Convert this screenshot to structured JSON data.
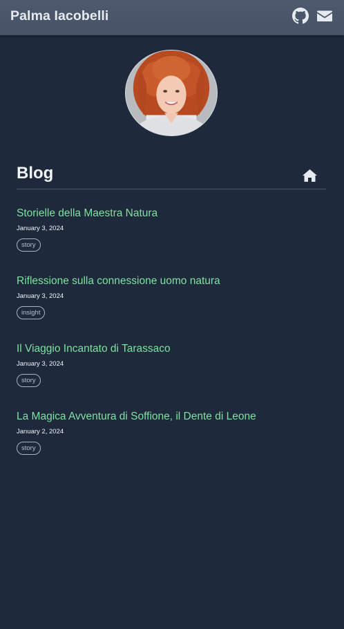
{
  "header": {
    "site_title": "Palma Iacobelli",
    "icons": [
      "github-icon",
      "envelope-icon"
    ]
  },
  "avatar": {
    "description": "profile-photo"
  },
  "section": {
    "title": "Blog",
    "home_icon": "home-icon"
  },
  "posts": [
    {
      "title": "Storielle della Maestra Natura",
      "date": "January 3, 2024",
      "tag": "story"
    },
    {
      "title": "Riflessione sulla connessione uomo natura",
      "date": "January 3, 2024",
      "tag": "insight"
    },
    {
      "title": "Il Viaggio Incantato di Tarassaco",
      "date": "January 3, 2024",
      "tag": "story"
    },
    {
      "title": "La Magica Avventura di Soffione, il Dente di Leone",
      "date": "January 2, 2024",
      "tag": "story"
    }
  ],
  "colors": {
    "background": "#1e293b",
    "header": "#4a5769",
    "link": "#7ee2a0",
    "text": "#f1f5f9"
  }
}
